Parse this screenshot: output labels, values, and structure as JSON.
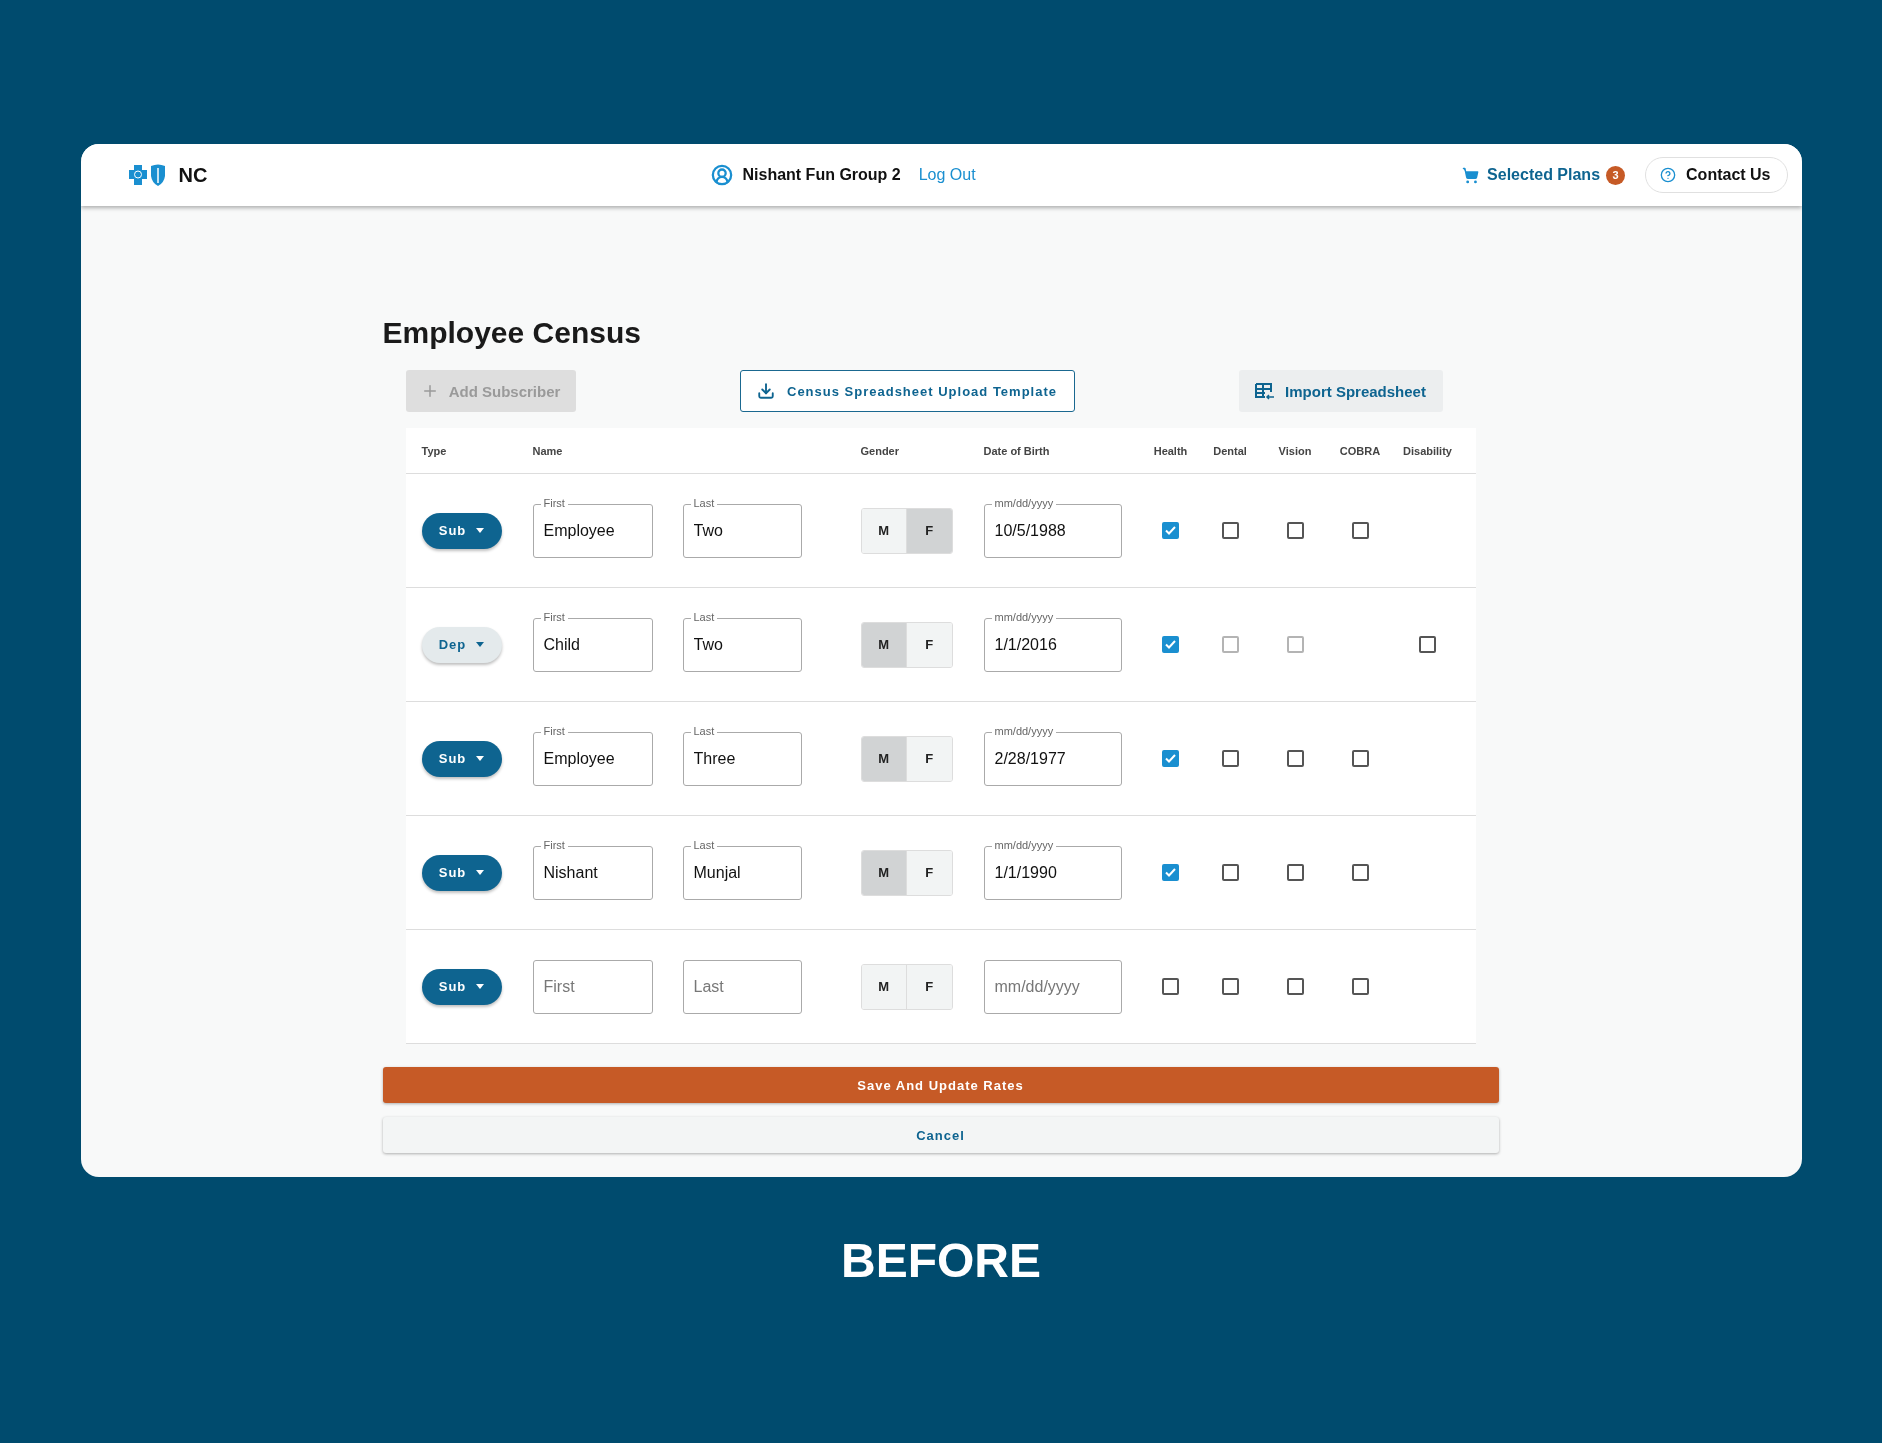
{
  "header": {
    "logo_text": "NC",
    "user": "Nishant Fun Group 2",
    "logout": "Log Out",
    "cart_label": "Selected Plans",
    "cart_count": "3",
    "contact": "Contact Us"
  },
  "page_title": "Employee Census",
  "toolbar": {
    "add": {
      "label": "Add Subscriber",
      "disabled": true
    },
    "template": "Census Spreadsheet Upload Template",
    "import": "Import Spreadsheet"
  },
  "table": {
    "columns": [
      "Type",
      "Name",
      "Gender",
      "Date of Birth",
      "Health",
      "Dental",
      "Vision",
      "COBRA",
      "Disability"
    ],
    "rows": [
      {
        "type": {
          "label": "Sub",
          "kind": "sub"
        },
        "first": {
          "label": "First",
          "value": "Employee"
        },
        "last": {
          "label": "Last",
          "value": "Two"
        },
        "gender": [
          {
            "label": "M",
            "selected": false
          },
          {
            "label": "F",
            "selected": true
          }
        ],
        "dob": {
          "label": "mm/dd/yyyy",
          "value": "10/5/1988"
        },
        "coverage": [
          {
            "kind": "checkbox",
            "checked": true,
            "disabled": false
          },
          {
            "kind": "checkbox",
            "checked": false,
            "disabled": false
          },
          {
            "kind": "checkbox",
            "checked": false,
            "disabled": false
          },
          {
            "kind": "checkbox",
            "checked": false,
            "disabled": false
          },
          {
            "kind": "none"
          }
        ]
      },
      {
        "type": {
          "label": "Dep",
          "kind": "dep"
        },
        "first": {
          "label": "First",
          "value": "Child"
        },
        "last": {
          "label": "Last",
          "value": "Two"
        },
        "gender": [
          {
            "label": "M",
            "selected": true
          },
          {
            "label": "F",
            "selected": false
          }
        ],
        "dob": {
          "label": "mm/dd/yyyy",
          "value": "1/1/2016"
        },
        "coverage": [
          {
            "kind": "checkbox",
            "checked": true,
            "disabled": false
          },
          {
            "kind": "checkbox",
            "checked": false,
            "disabled": true
          },
          {
            "kind": "checkbox",
            "checked": false,
            "disabled": true
          },
          {
            "kind": "none"
          },
          {
            "kind": "checkbox",
            "checked": false,
            "disabled": false
          }
        ]
      },
      {
        "type": {
          "label": "Sub",
          "kind": "sub"
        },
        "first": {
          "label": "First",
          "value": "Employee"
        },
        "last": {
          "label": "Last",
          "value": "Three"
        },
        "gender": [
          {
            "label": "M",
            "selected": true
          },
          {
            "label": "F",
            "selected": false
          }
        ],
        "dob": {
          "label": "mm/dd/yyyy",
          "value": "2/28/1977"
        },
        "coverage": [
          {
            "kind": "checkbox",
            "checked": true,
            "disabled": false
          },
          {
            "kind": "checkbox",
            "checked": false,
            "disabled": false
          },
          {
            "kind": "checkbox",
            "checked": false,
            "disabled": false
          },
          {
            "kind": "checkbox",
            "checked": false,
            "disabled": false
          },
          {
            "kind": "none"
          }
        ]
      },
      {
        "type": {
          "label": "Sub",
          "kind": "sub"
        },
        "first": {
          "label": "First",
          "value": "Nishant"
        },
        "last": {
          "label": "Last",
          "value": "Munjal"
        },
        "gender": [
          {
            "label": "M",
            "selected": true
          },
          {
            "label": "F",
            "selected": false
          }
        ],
        "dob": {
          "label": "mm/dd/yyyy",
          "value": "1/1/1990"
        },
        "coverage": [
          {
            "kind": "checkbox",
            "checked": true,
            "disabled": false
          },
          {
            "kind": "checkbox",
            "checked": false,
            "disabled": false
          },
          {
            "kind": "checkbox",
            "checked": false,
            "disabled": false
          },
          {
            "kind": "checkbox",
            "checked": false,
            "disabled": false
          },
          {
            "kind": "none"
          }
        ]
      },
      {
        "type": {
          "label": "Sub",
          "kind": "sub"
        },
        "first": {
          "placeholder": "First"
        },
        "last": {
          "placeholder": "Last"
        },
        "gender": [
          {
            "label": "M",
            "selected": false
          },
          {
            "label": "F",
            "selected": false
          }
        ],
        "dob": {
          "placeholder": "mm/dd/yyyy"
        },
        "coverage": [
          {
            "kind": "checkbox",
            "checked": false,
            "disabled": false
          },
          {
            "kind": "checkbox",
            "checked": false,
            "disabled": false
          },
          {
            "kind": "checkbox",
            "checked": false,
            "disabled": false
          },
          {
            "kind": "checkbox",
            "checked": false,
            "disabled": false
          },
          {
            "kind": "none"
          }
        ]
      }
    ]
  },
  "actions": {
    "save": "Save And Update Rates",
    "cancel": "Cancel"
  },
  "caption": "BEFORE"
}
